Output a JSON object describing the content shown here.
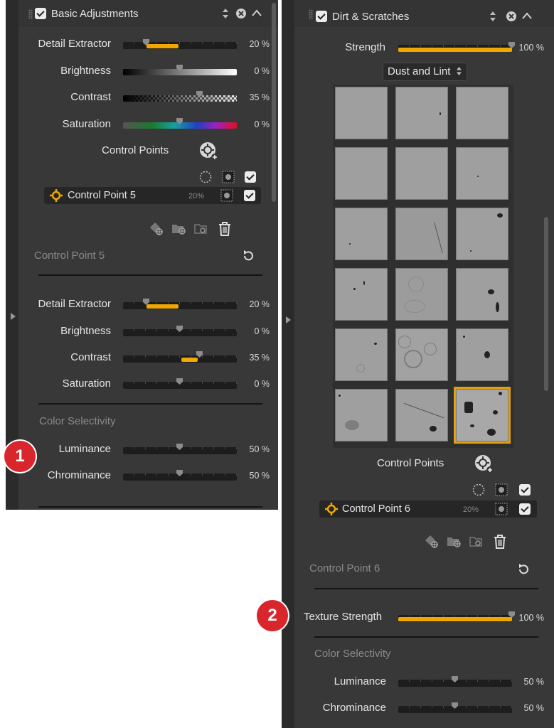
{
  "panel1": {
    "header_title": "Basic Adjustments",
    "sliders_top": [
      {
        "label": "Detail Extractor",
        "value": "20 %"
      },
      {
        "label": "Brightness",
        "value": "0 %"
      },
      {
        "label": "Contrast",
        "value": "35 %"
      },
      {
        "label": "Saturation",
        "value": "0 %"
      }
    ],
    "control_points_label": "Control Points",
    "control_point_row": {
      "name": "Control Point 5",
      "opacity": "20%"
    },
    "cp_section_title": "Control Point 5",
    "sliders_cp": [
      {
        "label": "Detail Extractor",
        "value": "20 %"
      },
      {
        "label": "Brightness",
        "value": "0 %"
      },
      {
        "label": "Contrast",
        "value": "35 %"
      },
      {
        "label": "Saturation",
        "value": "0 %"
      }
    ],
    "color_selectivity_title": "Color Selectivity",
    "sliders_cs": [
      {
        "label": "Luminance",
        "value": "50 %"
      },
      {
        "label": "Chrominance",
        "value": "50 %"
      }
    ],
    "badge": "1"
  },
  "panel2": {
    "header_title": "Dirt & Scratches",
    "strength": {
      "label": "Strength",
      "value": "100 %"
    },
    "preset_dropdown": "Dust and Lint",
    "control_points_label": "Control Points",
    "control_point_row": {
      "name": "Control Point 6",
      "opacity": "20%"
    },
    "cp_section_title": "Control Point 6",
    "texture_strength": {
      "label": "Texture Strength",
      "value": "100 %"
    },
    "color_selectivity_title": "Color Selectivity",
    "sliders_cs": [
      {
        "label": "Luminance",
        "value": "50 %"
      },
      {
        "label": "Chrominance",
        "value": "50 %"
      }
    ],
    "badge": "2"
  },
  "colors": {
    "accent": "#f0a800",
    "panel_bg": "#383838",
    "badge_red": "#d9252c"
  },
  "icons": [
    "drag-grip-icon",
    "sort-arrows-icon",
    "close-circle-icon",
    "chevron-up-icon",
    "add-control-point-icon",
    "crosshair-icon",
    "dotted-circle-icon",
    "mask-icon",
    "checkmark-icon",
    "duplicate-icon",
    "group-icon",
    "ungroup-icon",
    "trash-icon",
    "reset-icon",
    "side-expand-arrow-icon"
  ]
}
